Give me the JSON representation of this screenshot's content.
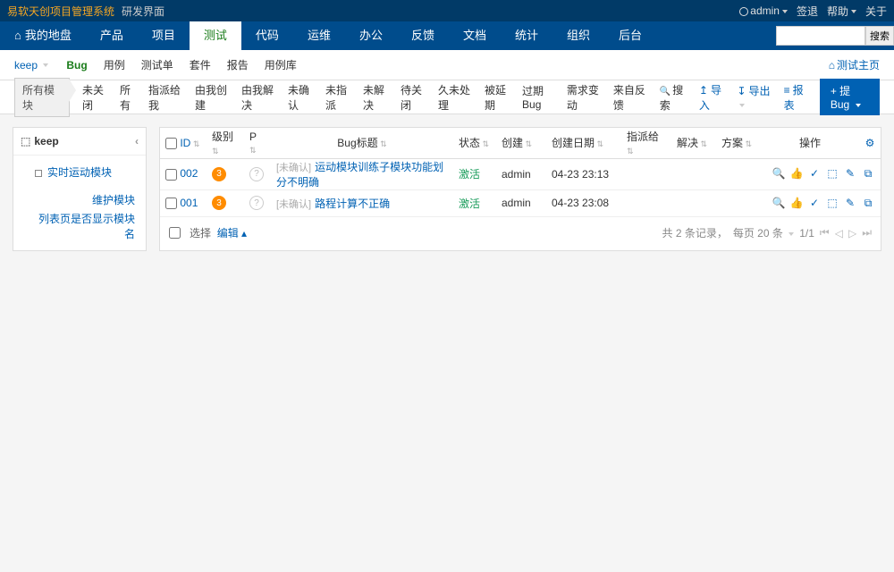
{
  "header": {
    "brand": "易软天创项目管理系统",
    "subtitle": "研发界面",
    "user": "admin",
    "logout": "签退",
    "help": "帮助",
    "about": "关于"
  },
  "main_nav": {
    "items": [
      "我的地盘",
      "产品",
      "项目",
      "测试",
      "代码",
      "运维",
      "办公",
      "反馈",
      "文档",
      "统计",
      "组织",
      "后台"
    ],
    "active_index": 3,
    "search_placeholder": "",
    "search_btn": "搜索"
  },
  "sub_nav": {
    "project": "keep",
    "tabs": [
      "Bug",
      "用例",
      "测试单",
      "套件",
      "报告",
      "用例库"
    ],
    "active_index": 0,
    "right_link": "测试主页"
  },
  "filter_bar": {
    "module_chip": "所有模块",
    "filters": [
      "未关闭",
      "所有",
      "指派给我",
      "由我创建",
      "由我解决",
      "未确认",
      "未指派",
      "未解决",
      "待关闭",
      "久未处理",
      "被延期",
      "过期Bug",
      "需求变动",
      "来自反馈",
      "搜索"
    ],
    "actions": {
      "import": "导入",
      "export": "导出",
      "report": "报表",
      "create": "提Bug"
    }
  },
  "sidebar": {
    "title": "keep",
    "modules": [
      "实时运动模块"
    ],
    "maintain": "维护模块",
    "show_col": "列表页是否显示模块名"
  },
  "table": {
    "columns": [
      "ID",
      "级别",
      "P",
      "Bug标题",
      "状态",
      "创建",
      "创建日期",
      "指派给",
      "解决",
      "方案",
      "操作"
    ],
    "rows": [
      {
        "id": "002",
        "sev": "3",
        "pri": "?",
        "unconfirm": "[未确认]",
        "title": "运动模块训练子模块功能划分不明确",
        "status": "激活",
        "creator": "admin",
        "date": "04-23 23:13"
      },
      {
        "id": "001",
        "sev": "3",
        "pri": "?",
        "unconfirm": "[未确认]",
        "title": "路程计算不正确",
        "status": "激活",
        "creator": "admin",
        "date": "04-23 23:08"
      }
    ]
  },
  "footer": {
    "select": "选择",
    "edit": "编辑",
    "total": "共 2 条记录，",
    "per_page": "每页 20 条",
    "page": "1/1"
  }
}
